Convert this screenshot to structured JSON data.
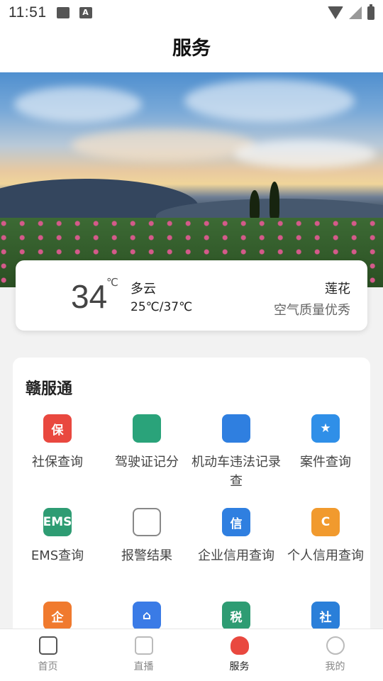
{
  "status": {
    "time": "11:51"
  },
  "page_title": "服务",
  "weather": {
    "temperature": "34",
    "unit": "℃",
    "condition": "多云",
    "range": "25℃/37℃",
    "city": "莲花",
    "air_quality": "空气质量优秀"
  },
  "services": {
    "title": "赣服通",
    "items": [
      {
        "label": "社保查询",
        "icon": "shield-bao-icon",
        "glyph": "保",
        "color": "#e9483f"
      },
      {
        "label": "驾驶证记分",
        "icon": "car-card-icon",
        "glyph": "",
        "color": "#2aa37a"
      },
      {
        "label": "机动车违法记录查",
        "icon": "car-search-icon",
        "glyph": "",
        "color": "#2f7fe0"
      },
      {
        "label": "案件查询",
        "icon": "star-shield-icon",
        "glyph": "★",
        "color": "#2f8fe8"
      },
      {
        "label": "EMS查询",
        "icon": "ems-icon",
        "glyph": "EMS",
        "color": "#2e9c73"
      },
      {
        "label": "报警结果",
        "icon": "alarm-icon",
        "glyph": "",
        "color": "#ffffff"
      },
      {
        "label": "企业信用查询",
        "icon": "building-credit-icon",
        "glyph": "信",
        "color": "#2f7fe0"
      },
      {
        "label": "个人信用查询",
        "icon": "credit-circle-icon",
        "glyph": "C",
        "color": "#f19a2e"
      },
      {
        "label": "",
        "icon": "enterprise-icon",
        "glyph": "企",
        "color": "#f07a2e"
      },
      {
        "label": "",
        "icon": "house-search-icon",
        "glyph": "⌂",
        "color": "#3a7be6"
      },
      {
        "label": "",
        "icon": "tax-icon",
        "glyph": "税",
        "color": "#2e9c73"
      },
      {
        "label": "",
        "icon": "social-icon",
        "glyph": "社",
        "color": "#2a7fd9"
      }
    ]
  },
  "tabs": [
    {
      "label": "首页",
      "icon": "home-icon"
    },
    {
      "label": "直播",
      "icon": "live-icon"
    },
    {
      "label": "服务",
      "icon": "heart-icon"
    },
    {
      "label": "我的",
      "icon": "profile-icon"
    }
  ]
}
